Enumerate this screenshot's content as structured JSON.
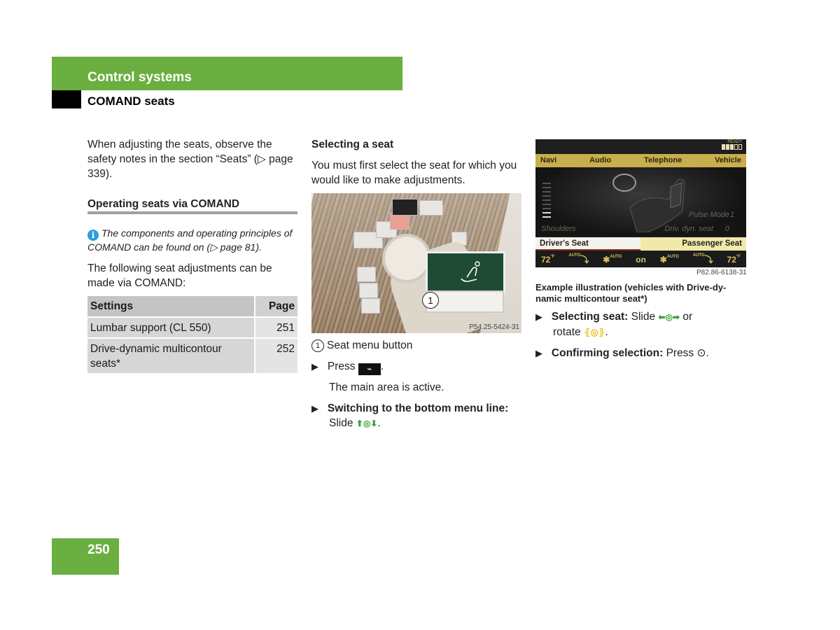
{
  "header": {
    "chapter": "Control systems",
    "section": "COMAND seats"
  },
  "col1": {
    "intro": "When adjusting the seats, observe the safety notes in the section “Seats” (▷ page 339).",
    "heading": "Operating seats via COMAND",
    "note": "The components and operating principles of COMAND can be found on (▷ page 81).",
    "list_intro": "The following seat adjustments can be made via COMAND:",
    "table": {
      "headers": [
        "Settings",
        "Page"
      ],
      "rows": [
        {
          "setting": "Lumbar support (CL 550)",
          "page": "251"
        },
        {
          "setting": "Drive-dynamic multicontour seats*",
          "page": "252"
        }
      ]
    }
  },
  "col2": {
    "heading": "Selecting a seat",
    "intro": "You must first select the seat for which you would like to make adjustments.",
    "photo_code": "P54.25-5424-31",
    "callout_num": "1",
    "legend": "Seat menu button",
    "step1_label": "Press",
    "step1_end": ".",
    "step1_result": "The main area is active.",
    "step2_bold": "Switching to the bottom menu line:",
    "step2_text": "Slide",
    "step2_symbol": "⬆◎⬇",
    "step2_end": "."
  },
  "comand": {
    "ready": "READY",
    "menu": [
      "Navi",
      "Audio",
      "Telephone",
      "Vehicle"
    ],
    "labels": {
      "shoulders": "Shoulders",
      "pulse_mode": "Pulse Mode",
      "pulse_value": "1",
      "drv_dyn": "Driv. dyn. seat",
      "drv_dyn_value": "0"
    },
    "tabs": {
      "driver": "Driver's Seat",
      "passenger": "Passenger Seat"
    },
    "bottom": {
      "temp_left": "72",
      "unit": "°F",
      "auto": "AUTO",
      "center": "on",
      "temp_right": "72"
    },
    "image_code": "P82.86-6138-31"
  },
  "col3": {
    "caption": "Example illustration (vehicles with Drive-dy-namic multicontour seat*)",
    "step1_bold": "Selecting seat:",
    "step1_text": "Slide",
    "step1_symbol": "⬅◎➡",
    "step1_or": "or",
    "step1_rotate": "rotate",
    "step1_rotate_symbol": "⦃◎⦄",
    "step1_end": ".",
    "step2_bold": "Confirming selection:",
    "step2_text": "Press",
    "step2_symbol": "⊙",
    "step2_end": "."
  },
  "footer": {
    "page_number": "250"
  },
  "colors": {
    "brand_green": "#6aaf3f",
    "comand_gold": "#c8ae4c",
    "info_blue": "#2a9ee0"
  }
}
